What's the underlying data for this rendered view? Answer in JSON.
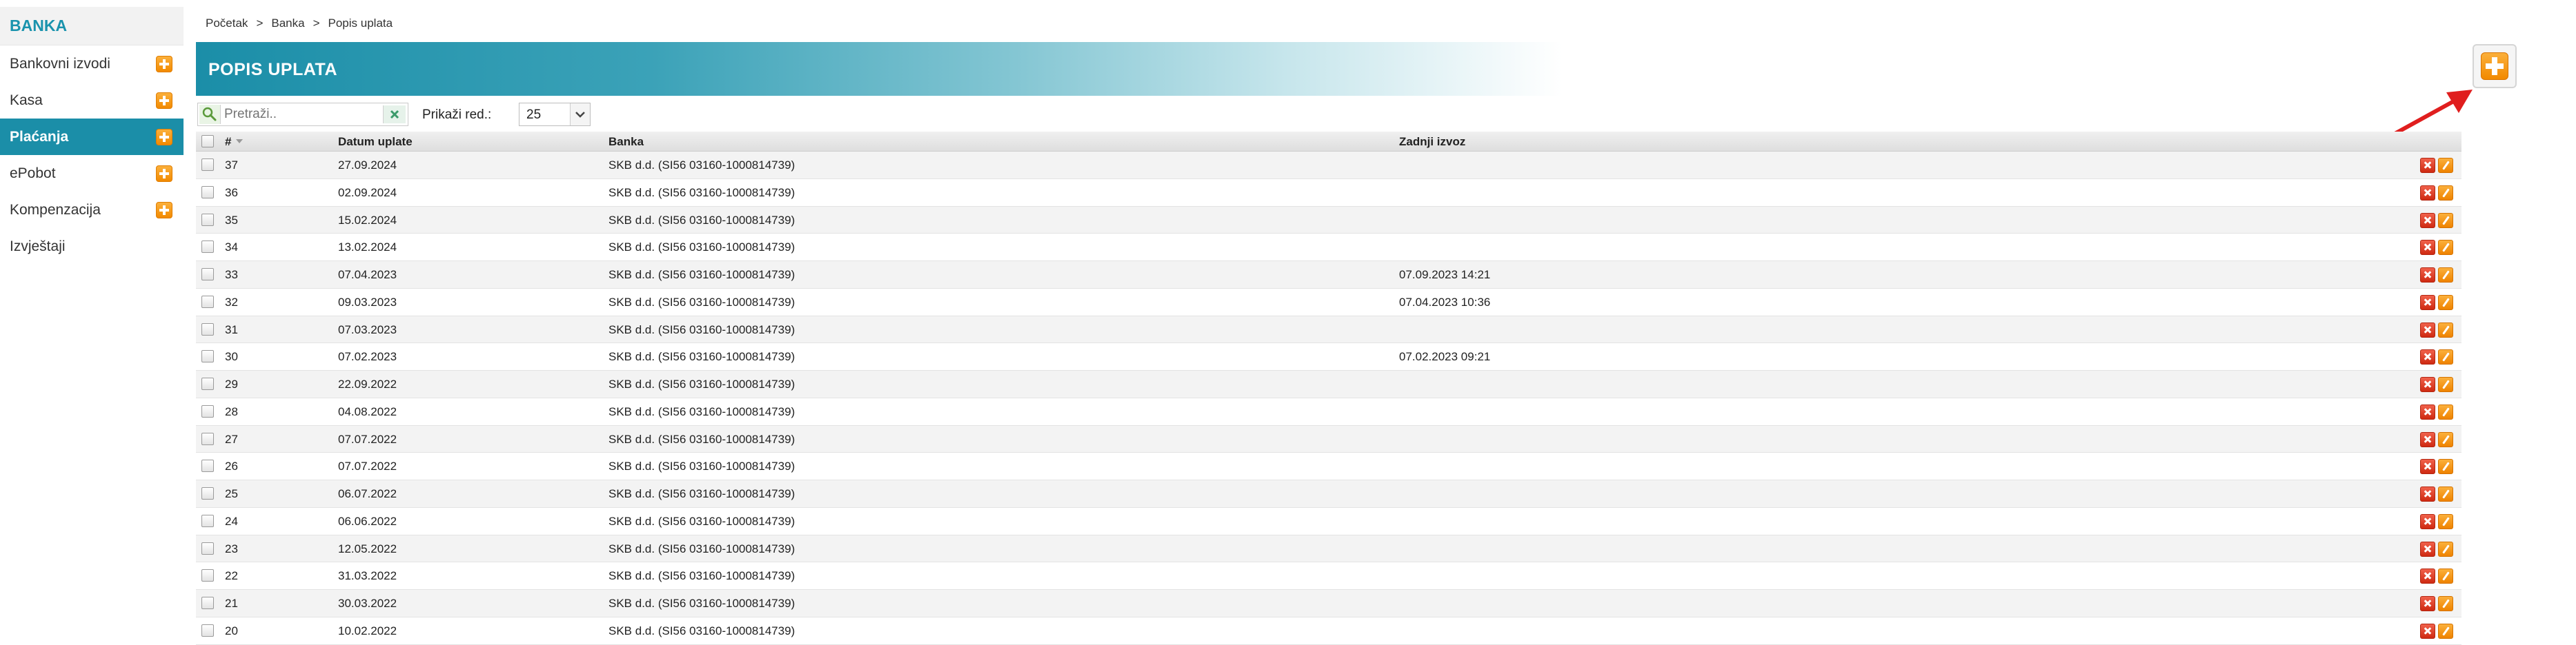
{
  "sidebar": {
    "title": "BANKA",
    "items": [
      {
        "label": "Bankovni izvodi",
        "has_add": true,
        "active": false
      },
      {
        "label": "Kasa",
        "has_add": true,
        "active": false
      },
      {
        "label": "Plaćanja",
        "has_add": true,
        "active": true
      },
      {
        "label": "ePobot",
        "has_add": true,
        "active": false
      },
      {
        "label": "Kompenzacija",
        "has_add": true,
        "active": false
      },
      {
        "label": "Izvještaji",
        "has_add": false,
        "active": false
      }
    ]
  },
  "breadcrumb": [
    "Početak",
    "Banka",
    "Popis uplata"
  ],
  "breadcrumb_separator": ">",
  "page_title": "POPIS UPLATA",
  "search": {
    "placeholder": "Pretraži..",
    "value": ""
  },
  "rows_label": "Prikaži red.:",
  "rows_per_page": "25",
  "table": {
    "headers": {
      "num": "#",
      "date": "Datum uplate",
      "bank": "Banka",
      "last_export": "Zadnji izvoz"
    },
    "rows": [
      {
        "num": "37",
        "date": "27.09.2024",
        "bank": "SKB d.d. (SI56 03160-1000814739)",
        "last_export": ""
      },
      {
        "num": "36",
        "date": "02.09.2024",
        "bank": "SKB d.d. (SI56 03160-1000814739)",
        "last_export": ""
      },
      {
        "num": "35",
        "date": "15.02.2024",
        "bank": "SKB d.d. (SI56 03160-1000814739)",
        "last_export": ""
      },
      {
        "num": "34",
        "date": "13.02.2024",
        "bank": "SKB d.d. (SI56 03160-1000814739)",
        "last_export": ""
      },
      {
        "num": "33",
        "date": "07.04.2023",
        "bank": "SKB d.d. (SI56 03160-1000814739)",
        "last_export": "07.09.2023 14:21"
      },
      {
        "num": "32",
        "date": "09.03.2023",
        "bank": "SKB d.d. (SI56 03160-1000814739)",
        "last_export": "07.04.2023 10:36"
      },
      {
        "num": "31",
        "date": "07.03.2023",
        "bank": "SKB d.d. (SI56 03160-1000814739)",
        "last_export": ""
      },
      {
        "num": "30",
        "date": "07.02.2023",
        "bank": "SKB d.d. (SI56 03160-1000814739)",
        "last_export": "07.02.2023 09:21"
      },
      {
        "num": "29",
        "date": "22.09.2022",
        "bank": "SKB d.d. (SI56 03160-1000814739)",
        "last_export": ""
      },
      {
        "num": "28",
        "date": "04.08.2022",
        "bank": "SKB d.d. (SI56 03160-1000814739)",
        "last_export": ""
      },
      {
        "num": "27",
        "date": "07.07.2022",
        "bank": "SKB d.d. (SI56 03160-1000814739)",
        "last_export": ""
      },
      {
        "num": "26",
        "date": "07.07.2022",
        "bank": "SKB d.d. (SI56 03160-1000814739)",
        "last_export": ""
      },
      {
        "num": "25",
        "date": "06.07.2022",
        "bank": "SKB d.d. (SI56 03160-1000814739)",
        "last_export": ""
      },
      {
        "num": "24",
        "date": "06.06.2022",
        "bank": "SKB d.d. (SI56 03160-1000814739)",
        "last_export": ""
      },
      {
        "num": "23",
        "date": "12.05.2022",
        "bank": "SKB d.d. (SI56 03160-1000814739)",
        "last_export": ""
      },
      {
        "num": "22",
        "date": "31.03.2022",
        "bank": "SKB d.d. (SI56 03160-1000814739)",
        "last_export": ""
      },
      {
        "num": "21",
        "date": "30.03.2022",
        "bank": "SKB d.d. (SI56 03160-1000814739)",
        "last_export": ""
      },
      {
        "num": "20",
        "date": "10.02.2022",
        "bank": "SKB d.d. (SI56 03160-1000814739)",
        "last_export": ""
      }
    ]
  },
  "icons": {
    "add": "plus-icon",
    "delete": "close-icon",
    "edit": "pencil-icon",
    "search": "search-icon",
    "clear": "clear-icon"
  },
  "colors": {
    "accent": "#1b8ea8",
    "add_button": "#f28a00",
    "delete_button": "#cf2a12",
    "annotation_arrow": "#e01e1e"
  }
}
